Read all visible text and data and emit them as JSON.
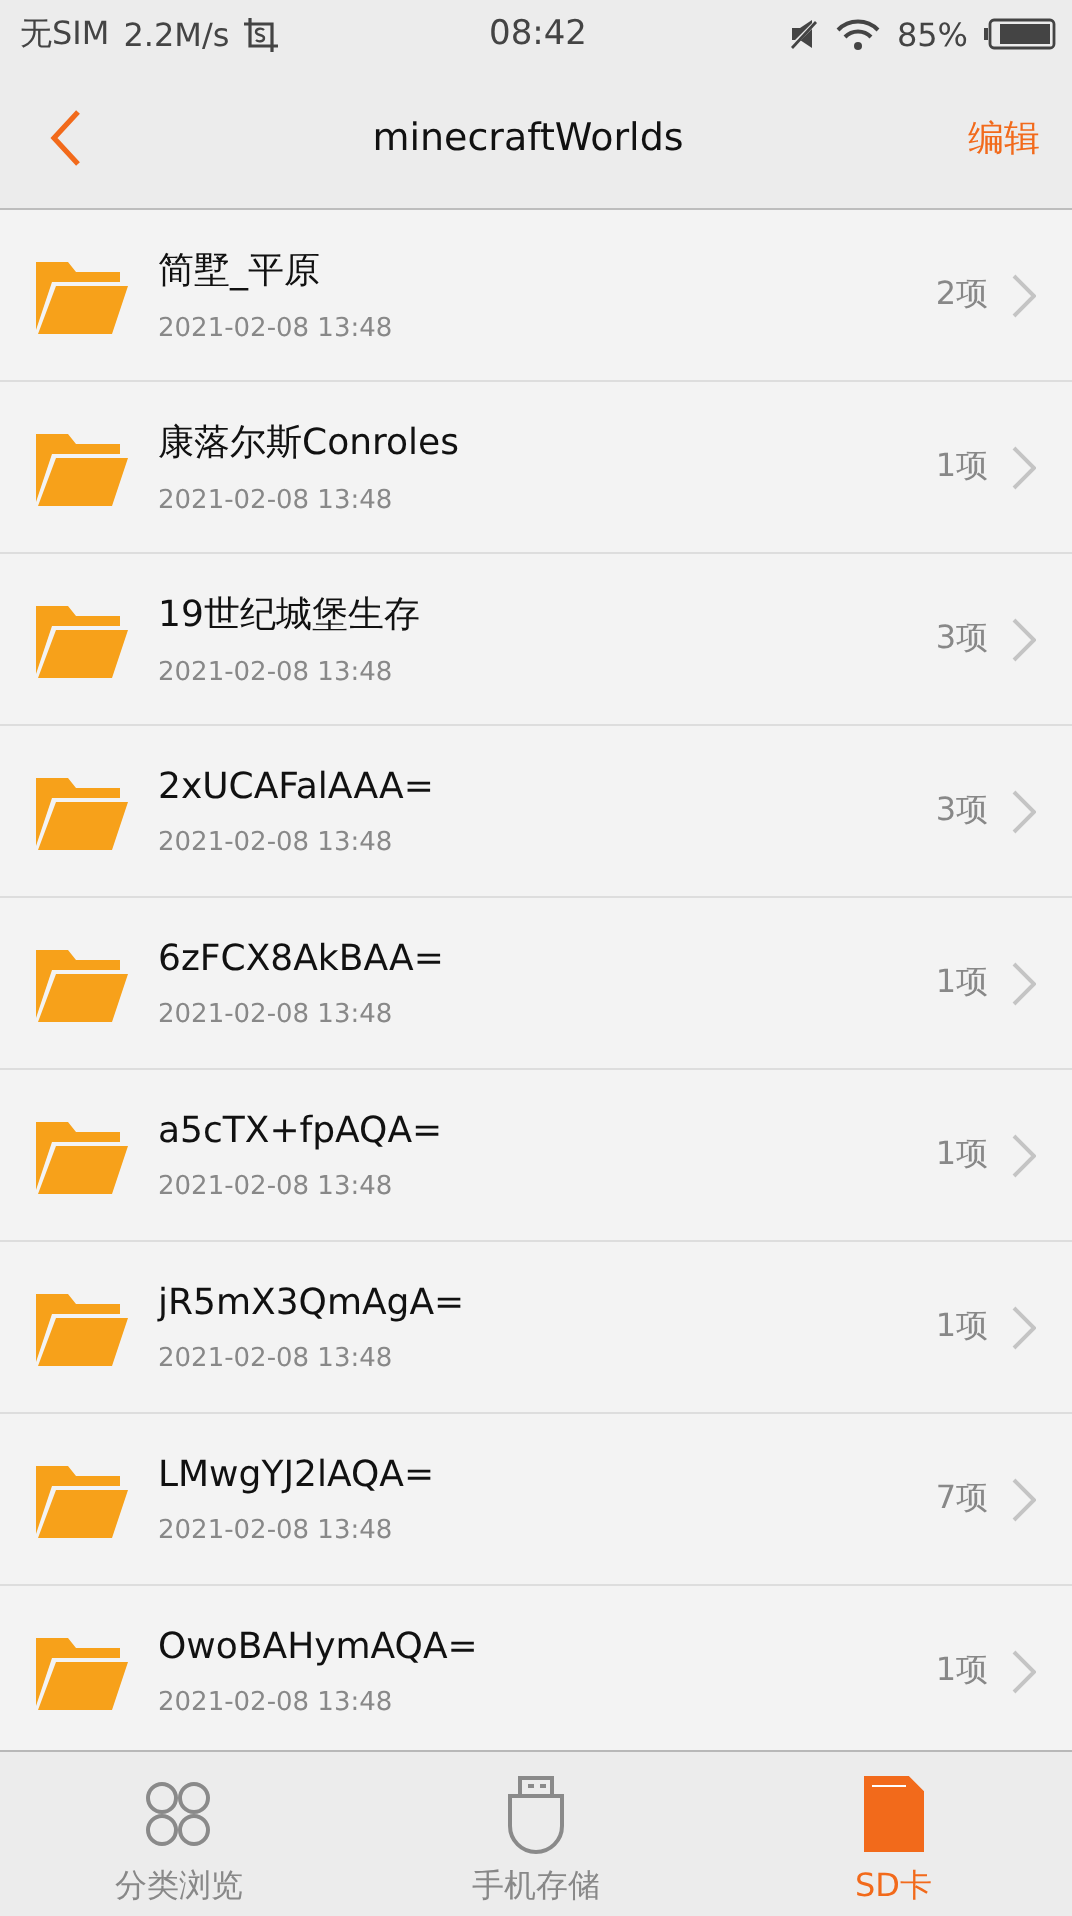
{
  "status_bar": {
    "carrier": "无SIM",
    "speed": "2.2M/s",
    "time": "08:42",
    "battery": "85%"
  },
  "header": {
    "title": "minecraftWorlds",
    "action": "编辑"
  },
  "folders": [
    {
      "name": "简墅_平原",
      "date": "2021-02-08 13:48",
      "count": "2项"
    },
    {
      "name": "康落尔斯Conroles",
      "date": "2021-02-08 13:48",
      "count": "1项"
    },
    {
      "name": "19世纪城堡生存",
      "date": "2021-02-08 13:48",
      "count": "3项"
    },
    {
      "name": "2xUCAFalAAA=",
      "date": "2021-02-08 13:48",
      "count": "3项"
    },
    {
      "name": "6zFCX8AkBAA=",
      "date": "2021-02-08 13:48",
      "count": "1项"
    },
    {
      "name": "a5cTX+fpAQA=",
      "date": "2021-02-08 13:48",
      "count": "1项"
    },
    {
      "name": "jR5mX3QmAgA=",
      "date": "2021-02-08 13:48",
      "count": "1项"
    },
    {
      "name": "LMwgYJ2lAQA=",
      "date": "2021-02-08 13:48",
      "count": "7项"
    },
    {
      "name": "OwoBAHymAQA=",
      "date": "2021-02-08 13:48",
      "count": "1项"
    }
  ],
  "tabs": [
    {
      "label": "分类浏览",
      "kind": "categories",
      "selected": false
    },
    {
      "label": "手机存储",
      "kind": "phone",
      "selected": false
    },
    {
      "label": "SD卡",
      "kind": "sdcard",
      "selected": true
    }
  ]
}
